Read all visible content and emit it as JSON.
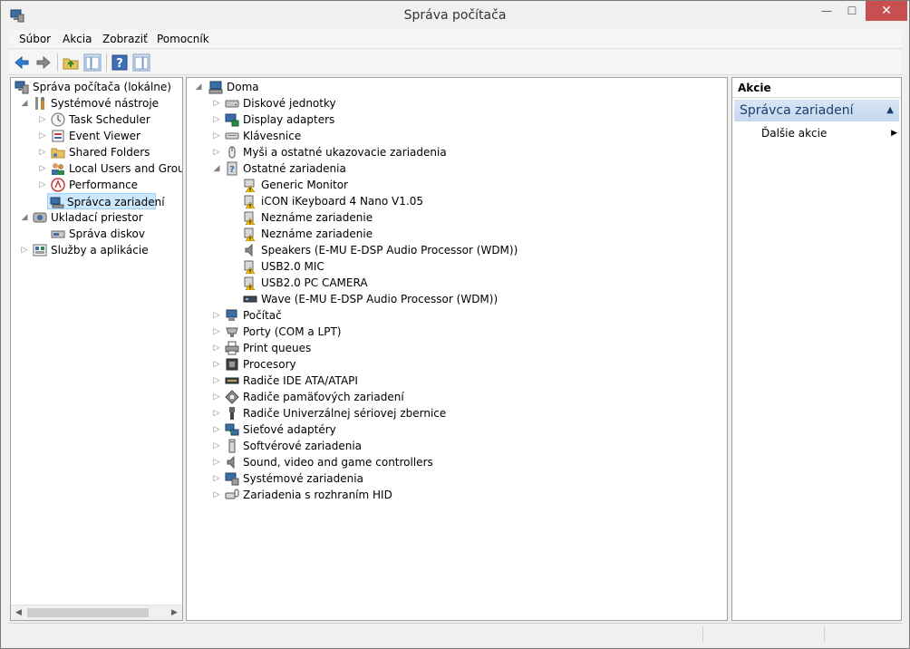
{
  "window": {
    "title": "Správa počítača"
  },
  "menu": [
    "Súbor",
    "Akcia",
    "Zobraziť",
    "Pomocník"
  ],
  "toolbar": [
    "back-icon",
    "forward-icon",
    "up-folder-icon",
    "show-hide-tree-icon",
    "help-icon",
    "show-hide-action-pane-icon"
  ],
  "left_tree": [
    {
      "label": "Správa počítača (lokálne)",
      "icon": "computer-management-icon"
    },
    {
      "label": "Systémové nástroje",
      "icon": "tools-icon"
    },
    {
      "label": "Task Scheduler",
      "icon": "clock-icon"
    },
    {
      "label": "Event Viewer",
      "icon": "event-viewer-icon"
    },
    {
      "label": "Shared Folders",
      "icon": "shared-folder-icon"
    },
    {
      "label": "Local Users and Groups",
      "icon": "users-icon"
    },
    {
      "label": "Performance",
      "icon": "performance-icon"
    },
    {
      "label": "Správca zariadení",
      "icon": "device-manager-icon"
    },
    {
      "label": "Ukladací priestor",
      "icon": "storage-icon"
    },
    {
      "label": "Správa diskov",
      "icon": "disk-management-icon"
    },
    {
      "label": "Služby a aplikácie",
      "icon": "services-icon"
    }
  ],
  "device_tree": {
    "root": "Doma",
    "items": [
      "Diskové jednotky",
      "Display adapters",
      "Klávesnice",
      "Myši a ostatné ukazovacie zariadenia",
      "Ostatné zariadenia",
      "Generic Monitor",
      "iCON iKeyboard 4 Nano V1.05",
      "Neznáme zariadenie",
      "Neznáme zariadenie",
      "Speakers (E-MU E-DSP Audio Processor (WDM))",
      "USB2.0 MIC",
      "USB2.0 PC CAMERA",
      "Wave (E-MU E-DSP Audio Processor (WDM))",
      "Počítač",
      "Porty (COM a LPT)",
      "Print queues",
      "Procesory",
      "Radiče IDE ATA/ATAPI",
      "Radiče pamäťových zariadení",
      "Radiče Univerzálnej sériovej zbernice",
      "Sieťové adaptéry",
      "Softvérové zariadenia",
      "Sound, video and game controllers",
      "Systémové zariadenia",
      "Zariadenia s rozhraním HID"
    ]
  },
  "actions": {
    "header": "Akcie",
    "section": "Správca zariadení",
    "more": "Ďalšie akcie"
  },
  "colors": {
    "selection": "#cce8ff",
    "close_button": "#c74f4f",
    "warning": "#f2c200"
  }
}
